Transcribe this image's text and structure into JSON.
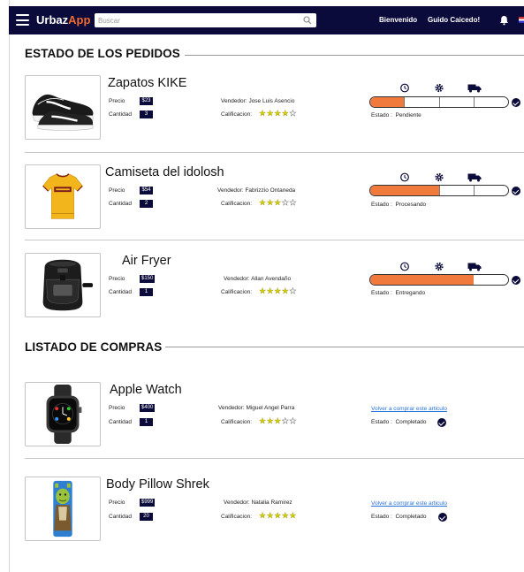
{
  "header": {
    "logo_part1": "Urbaz",
    "logo_part2": "App",
    "search_placeholder": "Buscar",
    "welcome": "Bienvenido",
    "user_name": "Guido Caicedo!",
    "icons": [
      "menu-icon",
      "search-icon",
      "bell-icon",
      "flag-icon"
    ],
    "colors": {
      "navbar": "#0b0b3b",
      "accent": "#f06b2f"
    }
  },
  "orders_section": {
    "title": "ESTADO DE LOS PEDIDOS",
    "tracker_icons": [
      "clock-icon",
      "gear-icon",
      "truck-icon"
    ],
    "orders": [
      {
        "name": "Zapatos KIKE",
        "price_label": "Precio",
        "price": "$23",
        "qty_label": "Cantidad",
        "qty": "3",
        "seller": "Vendedor: Jose Luis Asencio",
        "rating_label": "Calificacion:",
        "rating": 4,
        "rating_max": 5,
        "status_label": "Estado :",
        "status": "Pendiente",
        "progress_fraction": 0.25,
        "image_icon": "sneaker-image"
      },
      {
        "name": "Camiseta del idolosh",
        "price_label": "Precio",
        "price": "$54",
        "qty_label": "Cantidad",
        "qty": "2",
        "seller": "Vendedor: Fabrizzio Ontaneda",
        "rating_label": "Calificacion:",
        "rating": 3,
        "rating_max": 5,
        "status_label": "Estado :",
        "status": "Procesando",
        "progress_fraction": 0.5,
        "image_icon": "jersey-image"
      },
      {
        "name": "Air Fryer",
        "price_label": "Precio",
        "price": "$150",
        "qty_label": "Cantidad",
        "qty": "1",
        "seller": "Vendedor: Allan Avendaño",
        "rating_label": "Calificacion:",
        "rating": 4,
        "rating_max": 5,
        "status_label": "Estado :",
        "status": "Entregando",
        "progress_fraction": 0.75,
        "image_icon": "air-fryer-image"
      }
    ]
  },
  "purchases_section": {
    "title": "LISTADO DE COMPRAS",
    "purchases": [
      {
        "name": "Apple Watch",
        "price_label": "Precio",
        "price": "$400",
        "qty_label": "Cantidad",
        "qty": "1",
        "seller": "Vendedor: Miguel Angel Parra",
        "rating_label": "Calificacion:",
        "rating": 3,
        "rating_max": 5,
        "rebuy_link": "Volver a comprar este articulo",
        "status_label": "Estado :",
        "status": "Completado",
        "image_icon": "smartwatch-image"
      },
      {
        "name": "Body Pillow Shrek",
        "price_label": "Precio",
        "price": "$999",
        "qty_label": "Cantidad",
        "qty": "20",
        "seller": "Vendedor: Natalia Ramirez",
        "rating_label": "Calificacion:",
        "rating": 5,
        "rating_max": 5,
        "rebuy_link": "Volver a comprar este articulo",
        "status_label": "Estado :",
        "status": "Completado",
        "image_icon": "pillow-image"
      }
    ]
  }
}
